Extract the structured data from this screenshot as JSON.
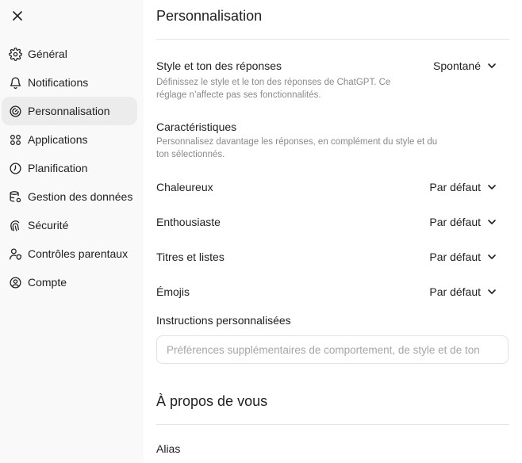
{
  "sidebar": {
    "close_icon": "close-icon",
    "items": [
      {
        "label": "Général",
        "icon": "gear-icon"
      },
      {
        "label": "Notifications",
        "icon": "bell-icon"
      },
      {
        "label": "Personnalisation",
        "icon": "personalization-icon"
      },
      {
        "label": "Applications",
        "icon": "apps-grid-icon"
      },
      {
        "label": "Planification",
        "icon": "clock-icon"
      },
      {
        "label": "Gestion des données",
        "icon": "database-gear-icon"
      },
      {
        "label": "Sécurité",
        "icon": "fingerprint-icon"
      },
      {
        "label": "Contrôles parentaux",
        "icon": "user-shield-icon"
      },
      {
        "label": "Compte",
        "icon": "user-circle-icon"
      }
    ],
    "active_index": 2
  },
  "main": {
    "title": "Personnalisation",
    "style": {
      "label": "Style et ton des réponses",
      "value": "Spontané",
      "description": "Définissez le style et le ton des réponses de ChatGPT. Ce réglage n’affecte pas ses fonctionnalités."
    },
    "characteristics": {
      "label": "Caractéristiques",
      "description": "Personnalisez davantage les réponses, en complément du style et du ton sélectionnés.",
      "rows": [
        {
          "label": "Chaleureux",
          "value": "Par défaut"
        },
        {
          "label": "Enthousiaste",
          "value": "Par défaut"
        },
        {
          "label": "Titres et listes",
          "value": "Par défaut"
        },
        {
          "label": "Émojis",
          "value": "Par défaut"
        }
      ]
    },
    "instructions": {
      "label": "Instructions personnalisées",
      "placeholder": "Préférences supplémentaires de comportement, de style et de ton",
      "value": ""
    },
    "about": {
      "title": "À propos de vous",
      "alias_label": "Alias"
    }
  },
  "colors": {
    "sidebar_bg": "#f9f9f9",
    "active_item_bg": "#ececec",
    "text": "#1f1f1f",
    "muted_text": "#8a8a8a",
    "divider": "#e5e5e5"
  }
}
